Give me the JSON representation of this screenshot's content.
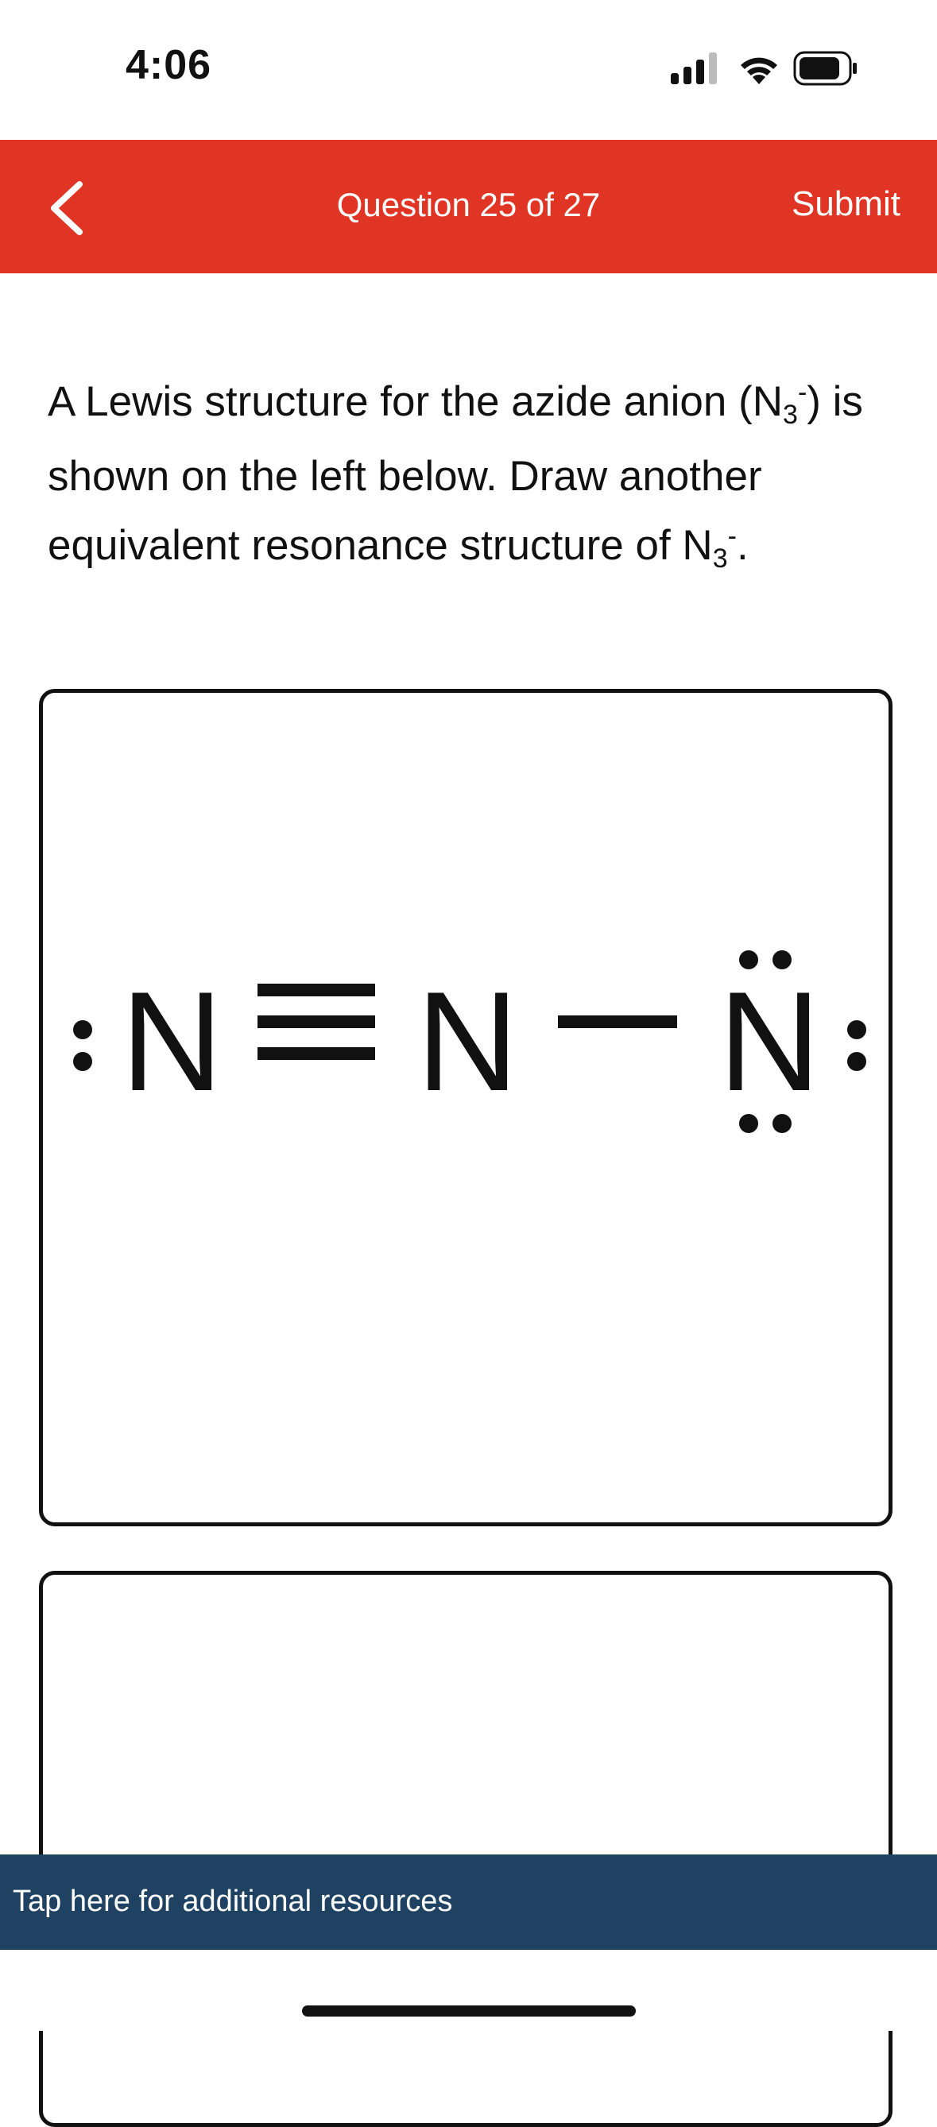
{
  "status_bar": {
    "time": "4:06",
    "icons": [
      "signal-icon",
      "wifi-icon",
      "battery-icon"
    ]
  },
  "nav": {
    "title": "Question 25 of 27",
    "submit_label": "Submit",
    "back_icon": "chevron-left-icon",
    "bar_color": "#e03524"
  },
  "question": {
    "part1": "A Lewis structure for the azide anion (N",
    "sub1": "3",
    "sup1": "-",
    "part2": ") is shown on the left below. Draw another equivalent resonance structure of N",
    "sub2": "3",
    "sup2": "-",
    "part3": "."
  },
  "lewis_structure": {
    "atoms": [
      "N",
      "N",
      "N"
    ],
    "bonds": [
      "triple",
      "single"
    ]
  },
  "resources": {
    "label": "Tap here for additional resources",
    "bar_color": "#1f4263"
  }
}
